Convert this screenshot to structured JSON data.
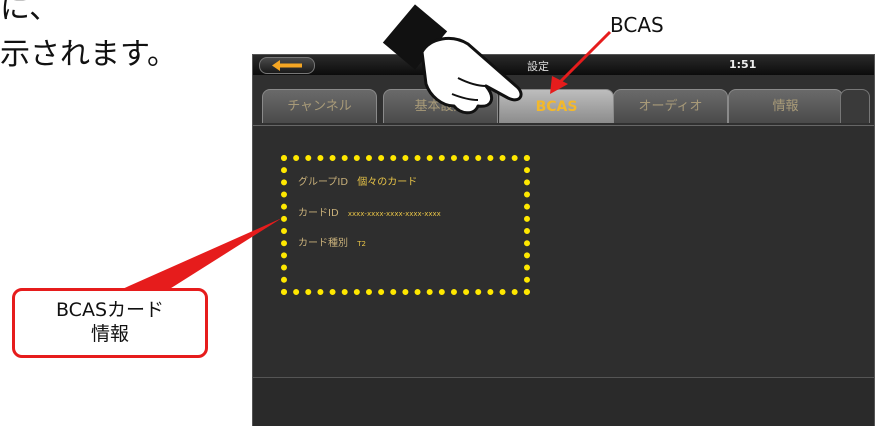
{
  "doc": {
    "line1": "に、",
    "line2": "示されます。"
  },
  "statusbar": {
    "title": "設定",
    "time": "1:51"
  },
  "tabs": [
    {
      "label": "チャンネル"
    },
    {
      "label": "基本設定"
    },
    {
      "label": "BCAS"
    },
    {
      "label": "オーディオ"
    },
    {
      "label": "情報"
    }
  ],
  "card_info": {
    "group_label": "グループID",
    "group_value": "個々のカード",
    "card_id_label": "カードID",
    "card_id_value": "xxxx-xxxx-xxxx-xxxx-xxxx",
    "card_type_label": "カード種別",
    "card_type_value": "T2"
  },
  "annotations": {
    "bcas_pointer_label": "BCAS",
    "callout_line1": "BCASカード",
    "callout_line2": "情報"
  },
  "colors": {
    "highlight": "#ffe800",
    "callout_border": "#e61c1c",
    "active_tab_text": "#f2b82c",
    "back_arrow": "#f5a623"
  },
  "icons": {
    "back": "left-arrow-icon",
    "pointer": "pointing-hand-icon"
  }
}
